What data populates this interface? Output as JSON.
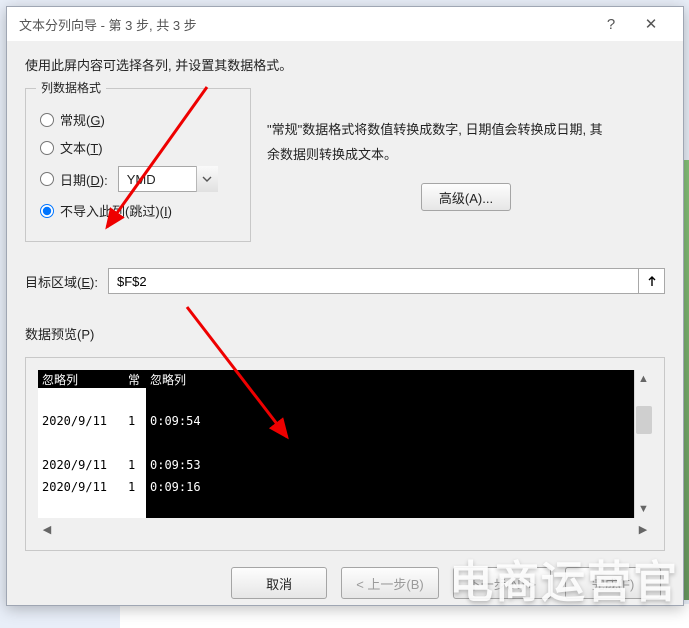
{
  "dialog": {
    "title": "文本分列向导 - 第 3 步, 共 3 步",
    "subtitle": "使用此屏内容可选择各列, 并设置其数据格式。",
    "help_char": "?",
    "close_char": "✕"
  },
  "column_format": {
    "legend": "列数据格式",
    "general_label": "常规(",
    "general_u": "G",
    "general_close": ")",
    "text_label": "文本(",
    "text_u": "T",
    "text_close": ")",
    "date_label": "日期(",
    "date_u": "D",
    "date_close": "):",
    "date_value": "YMD",
    "skip_label": "不导入此列(跳过)(",
    "skip_u": "I",
    "skip_close": ")",
    "selected": "skip"
  },
  "description": {
    "line1": "\"常规\"数据格式将数值转换成数字, 日期值会转换成日期, 其",
    "line2": "余数据则转换成文本。"
  },
  "advanced_button": "高级(A)...",
  "destination": {
    "label_pre": "目标区域(",
    "label_u": "E",
    "label_post": "):",
    "value": "$F$2"
  },
  "preview": {
    "label_pre": "数据预览(",
    "label_u": "P",
    "label_post": ")",
    "headers": {
      "col1": "忽略列",
      "col2": "常",
      "col3": "忽略列"
    },
    "rows": [
      {
        "c1": "",
        "c2": "",
        "c3": ""
      },
      {
        "c1": "2020/9/11",
        "c2": "1",
        "c3": "0:09:54"
      },
      {
        "c1": "",
        "c2": "",
        "c3": ""
      },
      {
        "c1": "2020/9/11",
        "c2": "1",
        "c3": "0:09:53"
      },
      {
        "c1": "2020/9/11",
        "c2": "1",
        "c3": "0:09:16"
      }
    ]
  },
  "chart_data": {
    "type": "table",
    "title": "数据预览",
    "columns": [
      "忽略列",
      "常",
      "忽略列"
    ],
    "rows": [
      [
        "2020/9/11",
        "1",
        "0:09:54"
      ],
      [
        "2020/9/11",
        "1",
        "0:09:53"
      ],
      [
        "2020/9/11",
        "1",
        "0:09:16"
      ]
    ]
  },
  "footer": {
    "cancel": "取消",
    "back": "< 上一步(B)",
    "next": "下一步(N) >",
    "finish": "完成(F)"
  },
  "watermark": "电商运营官"
}
